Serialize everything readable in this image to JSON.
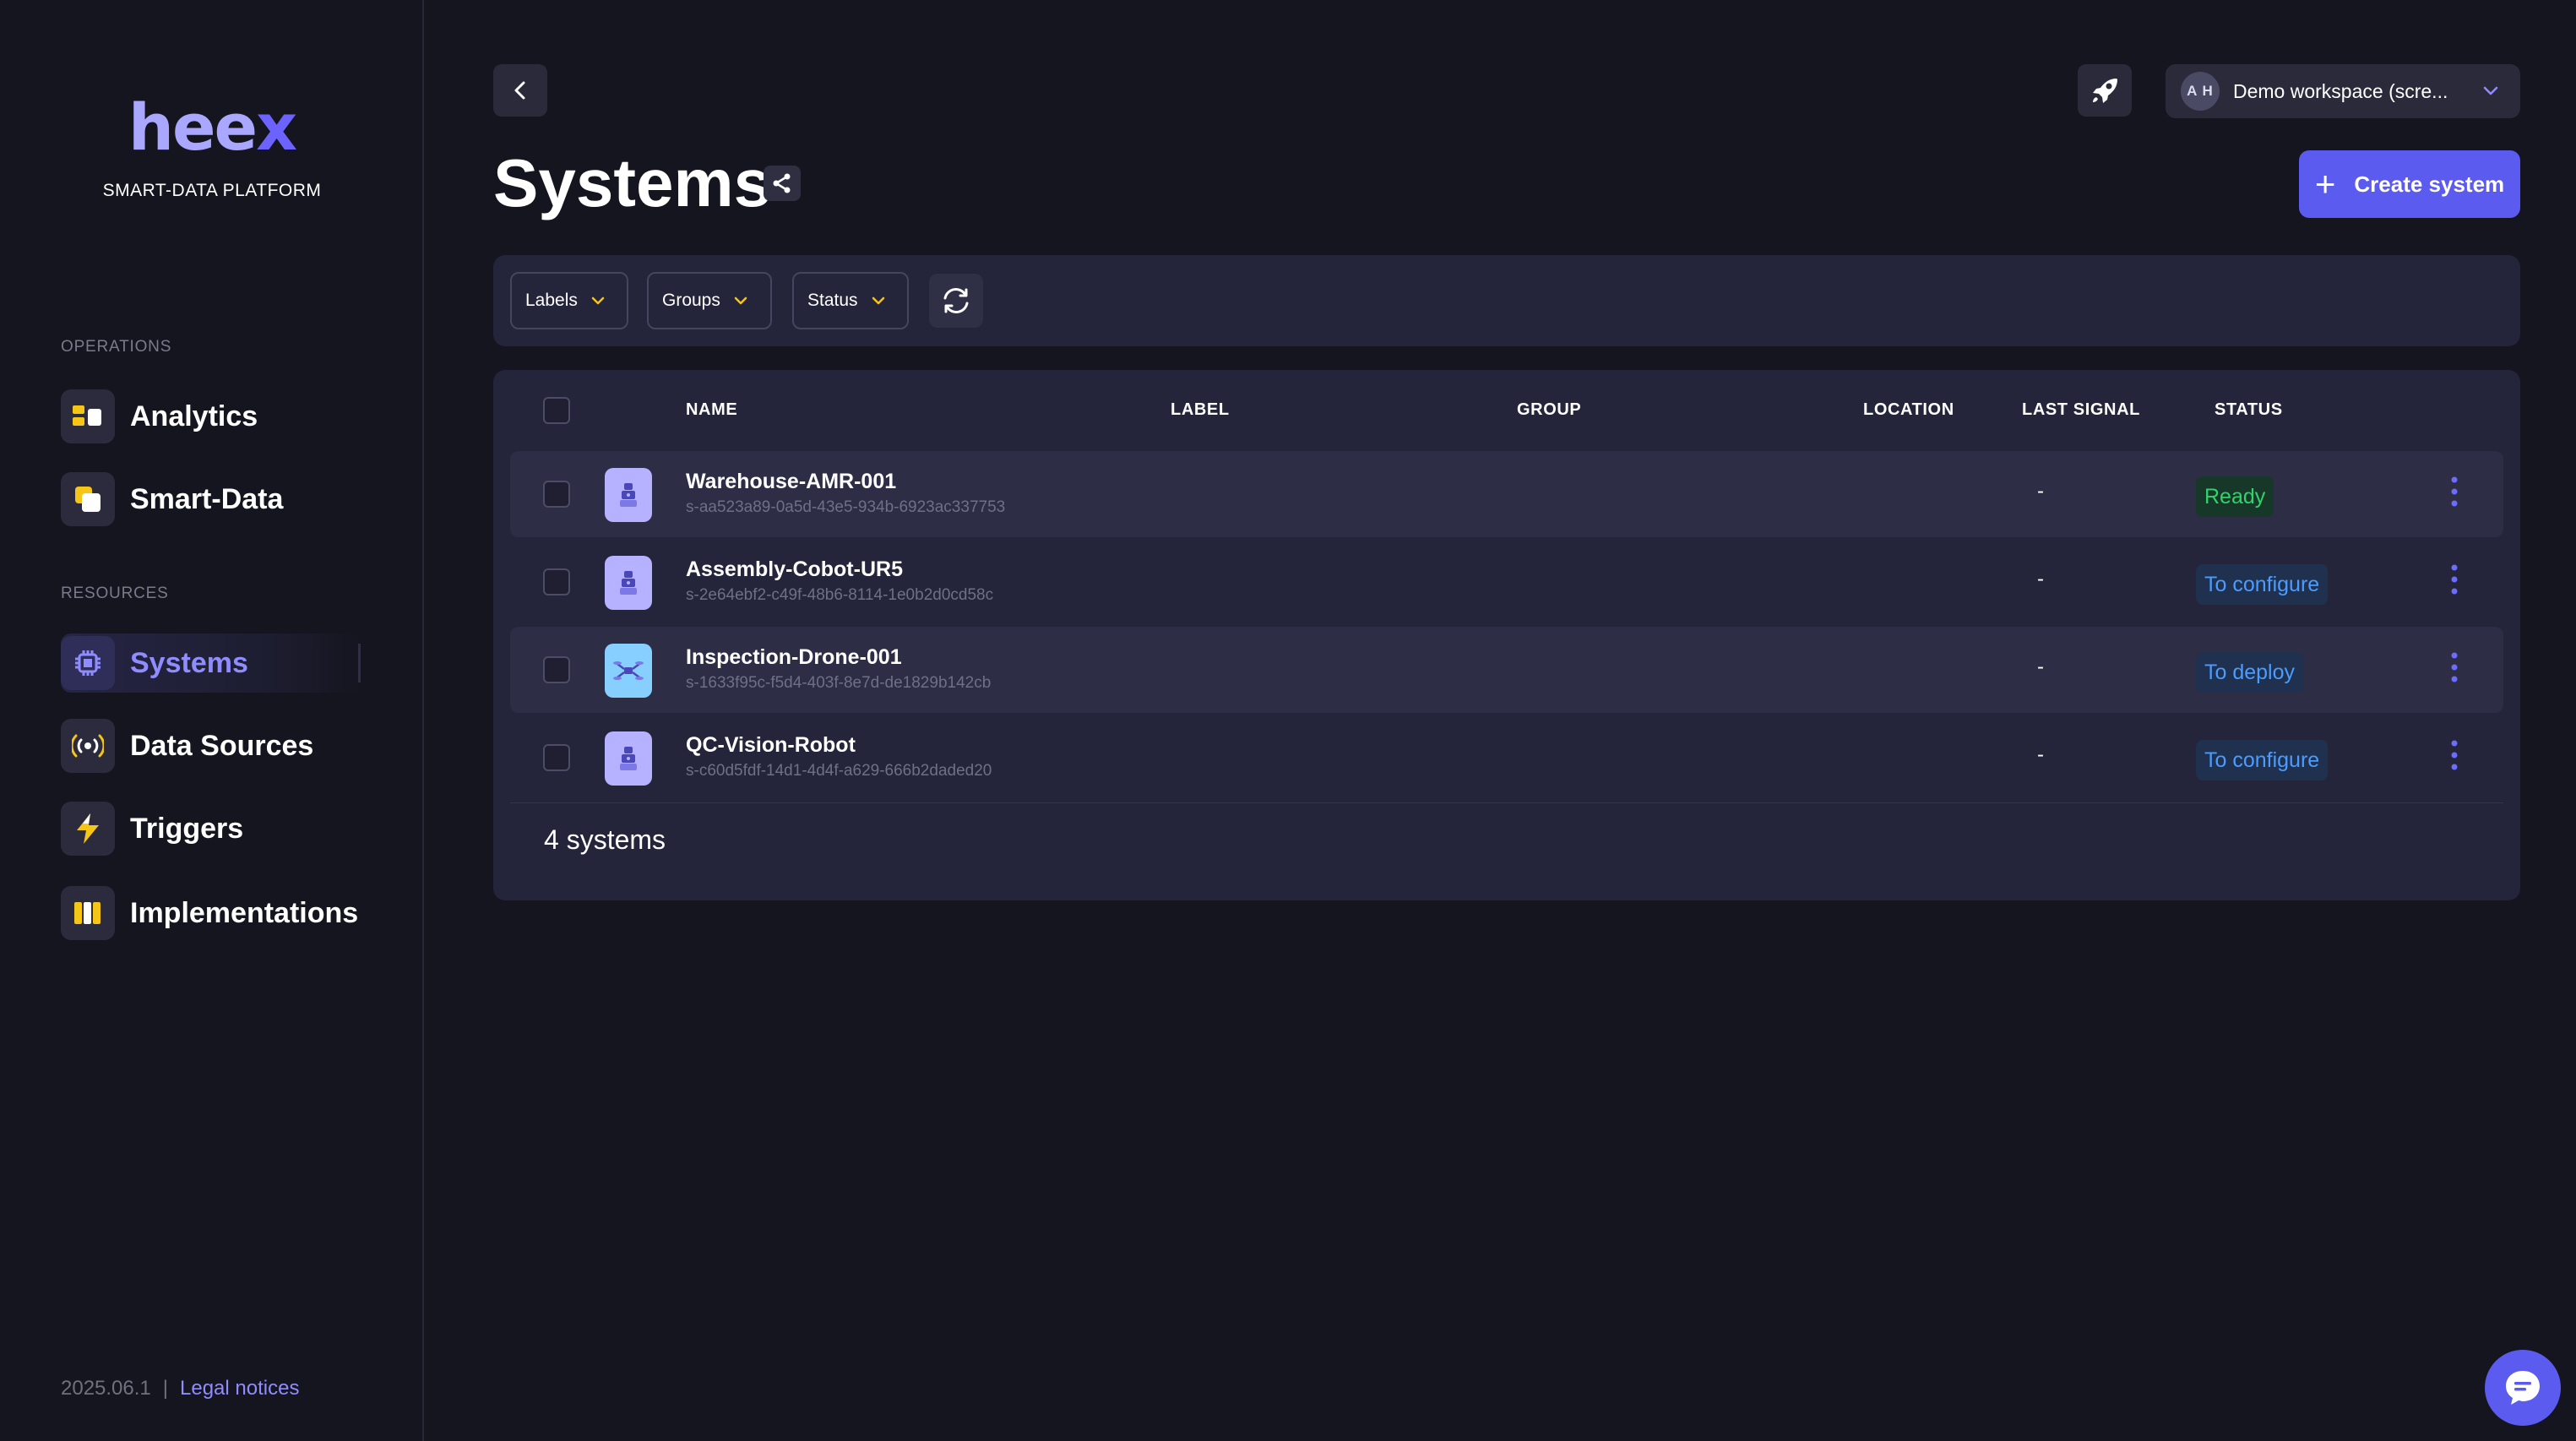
{
  "brand": {
    "logo_main": "hee",
    "logo_x": "x",
    "subtitle": "SMART-DATA PLATFORM"
  },
  "sidebar": {
    "sections": [
      {
        "label": "OPERATIONS"
      },
      {
        "label": "RESOURCES"
      }
    ],
    "items": [
      {
        "label": "Analytics",
        "icon": "analytics-icon"
      },
      {
        "label": "Smart-Data",
        "icon": "smart-data-icon"
      },
      {
        "label": "Systems",
        "icon": "chip-icon",
        "active": true
      },
      {
        "label": "Data Sources",
        "icon": "broadcast-icon"
      },
      {
        "label": "Triggers",
        "icon": "lightning-icon"
      },
      {
        "label": "Implementations",
        "icon": "columns-icon"
      }
    ],
    "version": "2025.06.1",
    "separator": "|",
    "legal": "Legal notices"
  },
  "header": {
    "workspace_initials": "A H",
    "workspace_name": "Demo workspace (scre...",
    "title": "Systems",
    "create_label": "Create system"
  },
  "filters": [
    {
      "label": "Labels"
    },
    {
      "label": "Groups"
    },
    {
      "label": "Status"
    }
  ],
  "table": {
    "columns": [
      "NAME",
      "LABEL",
      "GROUP",
      "LOCATION",
      "LAST SIGNAL",
      "STATUS"
    ],
    "rows": [
      {
        "name": "Warehouse-AMR-001",
        "id": "s-aa523a89-0a5d-43e5-934b-6923ac337753",
        "label": "",
        "group": "",
        "location": "",
        "last_signal": "-",
        "status": "Ready",
        "icon": "robot-icon"
      },
      {
        "name": "Assembly-Cobot-UR5",
        "id": "s-2e64ebf2-c49f-48b6-8114-1e0b2d0cd58c",
        "label": "",
        "group": "",
        "location": "",
        "last_signal": "-",
        "status": "To configure",
        "icon": "robot-icon"
      },
      {
        "name": "Inspection-Drone-001",
        "id": "s-1633f95c-f5d4-403f-8e7d-de1829b142cb",
        "label": "",
        "group": "",
        "location": "",
        "last_signal": "-",
        "status": "To deploy",
        "icon": "drone-icon"
      },
      {
        "name": "QC-Vision-Robot",
        "id": "s-c60d5fdf-14d1-4d4f-a629-666b2daded20",
        "label": "",
        "group": "",
        "location": "",
        "last_signal": "-",
        "status": "To configure",
        "icon": "robot-icon"
      }
    ],
    "count_label": "4 systems"
  },
  "colors": {
    "accent": "#5b5bf0",
    "ready": "#2fd46a",
    "pending": "#4a9cff",
    "background": "#15151f",
    "card": "#24243a"
  }
}
